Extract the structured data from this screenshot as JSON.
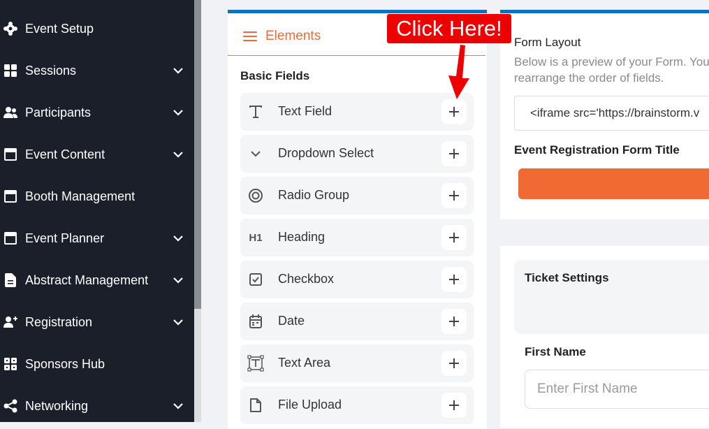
{
  "sidebar": {
    "items": [
      {
        "label": "Event Setup",
        "icon": "gear-icon",
        "has_chevron": false
      },
      {
        "label": "Sessions",
        "icon": "grid-icon",
        "has_chevron": true
      },
      {
        "label": "Participants",
        "icon": "users-icon",
        "has_chevron": true
      },
      {
        "label": "Event Content",
        "icon": "window-icon",
        "has_chevron": true
      },
      {
        "label": "Booth Management",
        "icon": "window-icon",
        "has_chevron": false
      },
      {
        "label": "Event Planner",
        "icon": "window-icon",
        "has_chevron": true
      },
      {
        "label": "Abstract Management",
        "icon": "document-icon",
        "has_chevron": true
      },
      {
        "label": "Registration",
        "icon": "user-plus-icon",
        "has_chevron": true
      },
      {
        "label": "Sponsors Hub",
        "icon": "grid-icon",
        "has_chevron": false
      },
      {
        "label": "Networking",
        "icon": "share-icon",
        "has_chevron": true
      }
    ]
  },
  "elements_panel": {
    "title": "Elements",
    "section_title": "Basic Fields",
    "fields": [
      {
        "label": "Text Field",
        "icon": "text-t-icon"
      },
      {
        "label": "Dropdown Select",
        "icon": "chevron-down-icon"
      },
      {
        "label": "Radio Group",
        "icon": "radio-icon"
      },
      {
        "label": "Heading",
        "icon": "heading-icon",
        "glyph": "H1"
      },
      {
        "label": "Checkbox",
        "icon": "checkbox-icon"
      },
      {
        "label": "Date",
        "icon": "calendar-icon"
      },
      {
        "label": "Text Area",
        "icon": "text-area-icon"
      },
      {
        "label": "File Upload",
        "icon": "file-icon"
      }
    ]
  },
  "callout": {
    "text": "Click Here!"
  },
  "form_layout": {
    "title": "Form Layout",
    "description_line1": "Below is a preview of your Form. You",
    "description_line2": "rearrange the order of fields.",
    "embed_code": "<iframe src='https://brainstorm.v",
    "form_title_label": "Event Registration Form Title"
  },
  "ticket": {
    "title": "Ticket Settings",
    "first_name_label": "First Name",
    "first_name_placeholder": "Enter First Name"
  },
  "colors": {
    "sidebar_bg": "#1b1f2a",
    "accent_orange": "#f26a33",
    "accent_blue": "#0d72b9",
    "callout_red": "#ee0000"
  }
}
